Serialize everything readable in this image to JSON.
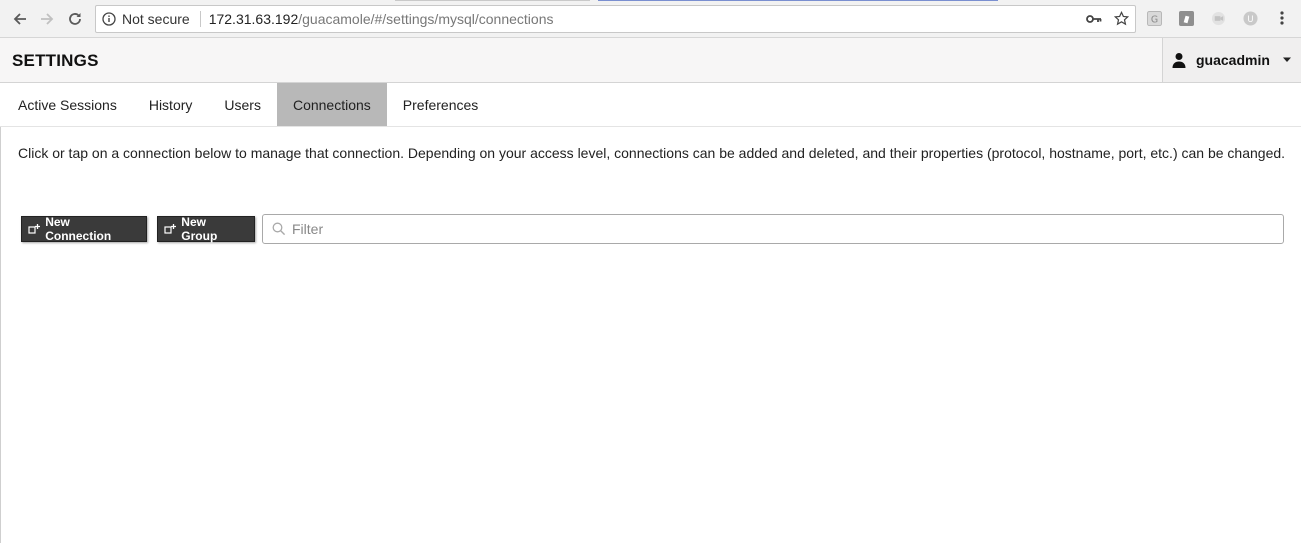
{
  "browser": {
    "back_icon": "arrow-left-icon",
    "forward_icon": "arrow-right-icon",
    "reload_icon": "reload-icon",
    "security_label": "Not secure",
    "url_host": "172.31.63.192",
    "url_path": "/guacamole/#/settings/mysql/connections",
    "key_icon": "key-icon",
    "star_icon": "star-icon",
    "extensions": [
      "g-extension-icon",
      "note-extension-icon",
      "video-extension-icon",
      "u-extension-icon"
    ],
    "menu_icon": "kebab-menu-icon"
  },
  "header": {
    "title": "SETTINGS",
    "user": {
      "name": "guacadmin",
      "icon": "user-icon",
      "caret": "caret-down-icon"
    }
  },
  "tabs": [
    {
      "label": "Active Sessions",
      "active": false
    },
    {
      "label": "History",
      "active": false
    },
    {
      "label": "Users",
      "active": false
    },
    {
      "label": "Connections",
      "active": true
    },
    {
      "label": "Preferences",
      "active": false
    }
  ],
  "main": {
    "description": "Click or tap on a connection below to manage that connection. Depending on your access level, connections can be added and deleted, and their properties (protocol, hostname, port, etc.) can be changed.",
    "new_connection_label": "New Connection",
    "new_group_label": "New Group",
    "filter_placeholder": "Filter",
    "filter_value": ""
  },
  "colors": {
    "active_tab": "#b8b8b8",
    "button_bg": "#3a3a3a",
    "header_bg": "#f7f6f6"
  }
}
